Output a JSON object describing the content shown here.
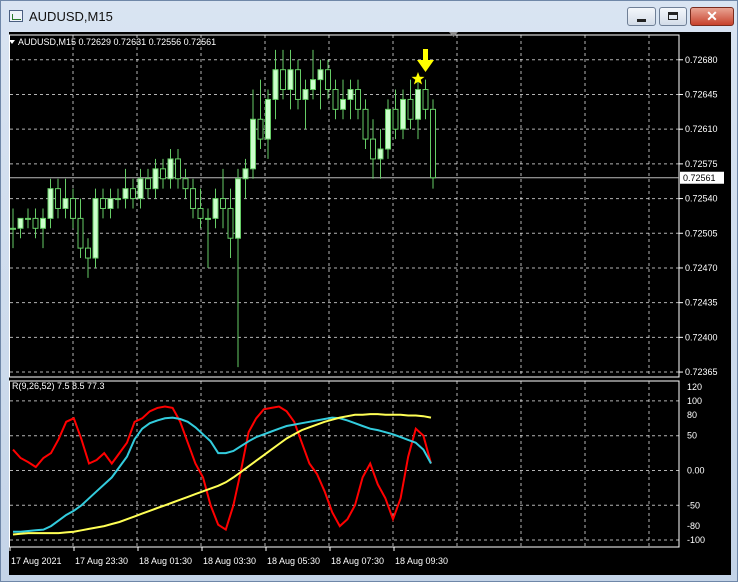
{
  "window": {
    "title": "AUDUSD,M15",
    "buttons": {
      "minimize": "minimize",
      "maximize": "maximize",
      "close": "✕"
    }
  },
  "main_panel": {
    "info": "AUDUSD,M15  0.72629 0.72631 0.72556 0.72561",
    "price_axis": [
      "0.72680",
      "0.72645",
      "0.72610",
      "0.72575",
      "0.72540",
      "0.72505",
      "0.72470",
      "0.72435",
      "0.72400",
      "0.72365"
    ],
    "current_price": "0.72561"
  },
  "indicator_panel": {
    "label": "R(9,26,52) 7.5 8.5 77.3",
    "axis": [
      "120",
      "100",
      "80",
      "50",
      "0.00",
      "-50",
      "-80",
      "-100"
    ]
  },
  "time_axis": [
    "17 Aug 2021",
    "17 Aug 23:30",
    "18 Aug 01:30",
    "18 Aug 03:30",
    "18 Aug 05:30",
    "18 Aug 07:30",
    "18 Aug 09:30"
  ],
  "colors": {
    "background": "#000000",
    "bull_candle": "#ccffcc",
    "bear_candle": "#000000",
    "wick": "#66cc66",
    "grid": "#ffffff",
    "red_line": "#ff0000",
    "cyan_line": "#33ccdd",
    "yellow_line": "#ffff55",
    "arrow": "#ffff00"
  },
  "chart_data": {
    "type": "candlestick",
    "symbol": "AUDUSD",
    "timeframe": "M15",
    "ylim": [
      0.7236,
      0.72705
    ],
    "ohlc": [
      [
        0.7251,
        0.7253,
        0.7249,
        0.7251
      ],
      [
        0.7251,
        0.7252,
        0.725,
        0.7252
      ],
      [
        0.7252,
        0.7253,
        0.7251,
        0.7252
      ],
      [
        0.7252,
        0.7253,
        0.725,
        0.7251
      ],
      [
        0.7251,
        0.7253,
        0.7249,
        0.7252
      ],
      [
        0.7252,
        0.7256,
        0.7251,
        0.7255
      ],
      [
        0.7255,
        0.7256,
        0.7252,
        0.7253
      ],
      [
        0.7253,
        0.7256,
        0.7252,
        0.7254
      ],
      [
        0.7254,
        0.7255,
        0.7251,
        0.7252
      ],
      [
        0.7252,
        0.7254,
        0.7248,
        0.7249
      ],
      [
        0.7249,
        0.725,
        0.7246,
        0.7248
      ],
      [
        0.7248,
        0.7255,
        0.7247,
        0.7254
      ],
      [
        0.7254,
        0.7255,
        0.7252,
        0.7253
      ],
      [
        0.7253,
        0.7255,
        0.7252,
        0.7254
      ],
      [
        0.7254,
        0.7255,
        0.7253,
        0.7254
      ],
      [
        0.7254,
        0.7257,
        0.7253,
        0.7255
      ],
      [
        0.7255,
        0.7256,
        0.7253,
        0.7254
      ],
      [
        0.7254,
        0.7257,
        0.7253,
        0.7256
      ],
      [
        0.7256,
        0.7257,
        0.7254,
        0.7255
      ],
      [
        0.7255,
        0.7258,
        0.7254,
        0.7257
      ],
      [
        0.7257,
        0.7258,
        0.7255,
        0.7256
      ],
      [
        0.7256,
        0.7259,
        0.7255,
        0.7258
      ],
      [
        0.7258,
        0.7259,
        0.7255,
        0.7256
      ],
      [
        0.7256,
        0.7257,
        0.7254,
        0.7255
      ],
      [
        0.7255,
        0.7256,
        0.7252,
        0.7253
      ],
      [
        0.7253,
        0.7255,
        0.7251,
        0.7252
      ],
      [
        0.7252,
        0.7253,
        0.7247,
        0.7252
      ],
      [
        0.7252,
        0.7255,
        0.7251,
        0.7254
      ],
      [
        0.7254,
        0.7257,
        0.7251,
        0.7253
      ],
      [
        0.7253,
        0.7255,
        0.7248,
        0.725
      ],
      [
        0.725,
        0.7257,
        0.7237,
        0.7256
      ],
      [
        0.7256,
        0.7258,
        0.7254,
        0.7257
      ],
      [
        0.7257,
        0.7265,
        0.7256,
        0.7262
      ],
      [
        0.7262,
        0.7266,
        0.7259,
        0.726
      ],
      [
        0.726,
        0.7265,
        0.7258,
        0.7264
      ],
      [
        0.7264,
        0.7269,
        0.7262,
        0.7267
      ],
      [
        0.7267,
        0.7269,
        0.7264,
        0.7265
      ],
      [
        0.7265,
        0.7269,
        0.7263,
        0.7267
      ],
      [
        0.7267,
        0.7268,
        0.7263,
        0.7264
      ],
      [
        0.7264,
        0.7266,
        0.7261,
        0.7265
      ],
      [
        0.7265,
        0.7269,
        0.7264,
        0.7266
      ],
      [
        0.7266,
        0.7268,
        0.7263,
        0.7267
      ],
      [
        0.7267,
        0.7268,
        0.7264,
        0.7265
      ],
      [
        0.7265,
        0.7266,
        0.7262,
        0.7263
      ],
      [
        0.7263,
        0.7266,
        0.7262,
        0.7264
      ],
      [
        0.7264,
        0.7266,
        0.7262,
        0.7265
      ],
      [
        0.7265,
        0.7266,
        0.7262,
        0.7263
      ],
      [
        0.7263,
        0.7264,
        0.7259,
        0.726
      ],
      [
        0.726,
        0.7262,
        0.7256,
        0.7258
      ],
      [
        0.7258,
        0.7261,
        0.7256,
        0.7259
      ],
      [
        0.7259,
        0.7264,
        0.7258,
        0.7263
      ],
      [
        0.7263,
        0.7265,
        0.726,
        0.7261
      ],
      [
        0.7261,
        0.7265,
        0.726,
        0.7264
      ],
      [
        0.7264,
        0.7266,
        0.7261,
        0.7262
      ],
      [
        0.7262,
        0.7266,
        0.726,
        0.7265
      ],
      [
        0.7265,
        0.7266,
        0.7262,
        0.7263
      ],
      [
        0.7263,
        0.7264,
        0.7255,
        0.72561
      ]
    ],
    "series": [
      {
        "values": [
          30,
          18,
          12,
          5,
          18,
          25,
          45,
          70,
          75,
          45,
          10,
          15,
          25,
          10,
          25,
          40,
          70,
          75,
          85,
          90,
          92,
          90,
          70,
          40,
          10,
          -10,
          -50,
          -78,
          -85,
          -50,
          0,
          55,
          75,
          88,
          90,
          92,
          85,
          70,
          40,
          10,
          -5,
          -30,
          -60,
          -80,
          -70,
          -50,
          -10,
          10,
          -20,
          -40,
          -70,
          -40,
          20,
          60,
          50,
          10
        ]
      },
      {
        "values": [
          -88,
          -88,
          -87,
          -86,
          -85,
          -80,
          -72,
          -64,
          -58,
          -50,
          -40,
          -30,
          -20,
          -10,
          5,
          20,
          45,
          60,
          68,
          72,
          75,
          76,
          74,
          70,
          62,
          52,
          42,
          25,
          25,
          28,
          35,
          42,
          48,
          52,
          56,
          60,
          64,
          66,
          68,
          70,
          72,
          74,
          76,
          75,
          72,
          68,
          64,
          60,
          58,
          55,
          52,
          48,
          44,
          40,
          30,
          10
        ]
      },
      {
        "values": [
          -92,
          -91,
          -90,
          -90,
          -90,
          -90,
          -90,
          -89,
          -88,
          -86,
          -84,
          -82,
          -80,
          -77,
          -74,
          -70,
          -66,
          -62,
          -58,
          -54,
          -50,
          -46,
          -42,
          -38,
          -34,
          -30,
          -26,
          -22,
          -17,
          -10,
          -2,
          6,
          14,
          22,
          30,
          38,
          46,
          52,
          58,
          62,
          66,
          70,
          73,
          76,
          78,
          80,
          80,
          81,
          81,
          80,
          80,
          80,
          79,
          79,
          78,
          76
        ]
      }
    ]
  }
}
